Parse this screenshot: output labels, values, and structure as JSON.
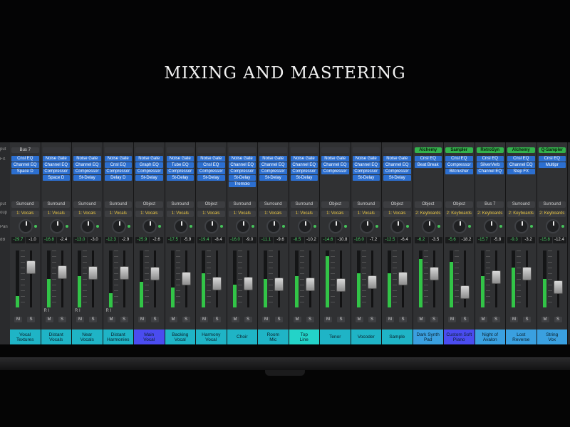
{
  "title": "MIXING AND MASTERING",
  "row_labels": [
    "put",
    "FX",
    "put",
    "oup",
    "Pan",
    "dB"
  ],
  "channels": [
    {
      "name": "Vocal\nTextures",
      "color": "#1fb4c6",
      "io": "Bus 7",
      "io_green": false,
      "plugins": [
        "Cnsl EQ",
        "Channel EQ",
        "Space D"
      ],
      "output": "Surround",
      "group": "1: Vocals",
      "vol": "-29.7",
      "peak": "-1.0",
      "meter": 0.2,
      "fader": 0.75
    },
    {
      "name": "Distant\nVocals",
      "color": "#1fb4c6",
      "io": "",
      "io_green": false,
      "plugins": [
        "Noise Gate",
        "Channel EQ",
        "Compressor",
        "Space D"
      ],
      "output": "Surround",
      "group": "1: Vocals",
      "vol": "-16.8",
      "peak": "-2.4",
      "meter": 0.5,
      "fader": 0.65
    },
    {
      "name": "Near\nVocals",
      "color": "#1fb4c6",
      "io": "",
      "io_green": false,
      "plugins": [
        "Noise Gate",
        "Channel EQ",
        "Compressor",
        "St-Delay"
      ],
      "output": "Surround",
      "group": "1: Vocals",
      "vol": "-13.0",
      "peak": "-3.0",
      "meter": 0.55,
      "fader": 0.63
    },
    {
      "name": "Distant\nHarmonies",
      "color": "#1fb4c6",
      "io": "",
      "io_green": false,
      "plugins": [
        "Noise Gate",
        "Cnsl EQ",
        "Compressor",
        "Delay D"
      ],
      "output": "Surround",
      "group": "1: Vocals",
      "vol": "-12.3",
      "peak": "-2.9",
      "meter": 0.25,
      "fader": 0.63
    },
    {
      "name": "Main\nVocal",
      "color": "#4a4cf0",
      "io": "",
      "io_green": false,
      "plugins": [
        "Noise Gate",
        "Graph EQ",
        "Compressor",
        "St-Delay"
      ],
      "output": "Object",
      "group": "1: Vocals",
      "vol": "-25.9",
      "peak": "-2.6",
      "meter": 0.45,
      "fader": 0.62
    },
    {
      "name": "Backing\nVocal",
      "color": "#1fb4c6",
      "io": "",
      "io_green": false,
      "plugins": [
        "Noise Gate",
        "Tube EQ",
        "Compressor",
        "St-Delay"
      ],
      "output": "Surround",
      "group": "1: Vocals",
      "vol": "-17.5",
      "peak": "-5.9",
      "meter": 0.35,
      "fader": 0.52
    },
    {
      "name": "Harmony\nVocal",
      "color": "#1fb4c6",
      "io": "",
      "io_green": false,
      "plugins": [
        "Noise Gate",
        "Cnsl EQ",
        "Compressor",
        "St-Delay"
      ],
      "output": "Object",
      "group": "1: Vocals",
      "vol": "-19.4",
      "peak": "-8.4",
      "meter": 0.6,
      "fader": 0.42
    },
    {
      "name": "Choir",
      "color": "#1fb4c6",
      "io": "",
      "io_green": false,
      "plugins": [
        "Noise Gate",
        "Channel EQ",
        "Compressor",
        "St-Delay",
        "Tremolo"
      ],
      "output": "Surround",
      "group": "1: Vocals",
      "vol": "-16.0",
      "peak": "-9.0",
      "meter": 0.4,
      "fader": 0.42
    },
    {
      "name": "Room\nMic",
      "color": "#1fb4c6",
      "io": "",
      "io_green": false,
      "plugins": [
        "Noise Gate",
        "Channel EQ",
        "Compressor",
        "St-Delay"
      ],
      "output": "Surround",
      "group": "1: Vocals",
      "vol": "-11.1",
      "peak": "-9.6",
      "meter": 0.5,
      "fader": 0.4
    },
    {
      "name": "Top\nLine",
      "color": "#23d3c8",
      "io": "",
      "io_green": false,
      "plugins": [
        "Noise Gate",
        "Channel EQ",
        "Compressor",
        "St-Delay"
      ],
      "output": "Surround",
      "group": "1: Vocals",
      "vol": "-8.5",
      "peak": "-10.2",
      "meter": 0.55,
      "fader": 0.4
    },
    {
      "name": "Tenor",
      "color": "#1fb4c6",
      "io": "",
      "io_green": false,
      "plugins": [
        "Noise Gate",
        "Channel EQ",
        "Compressor"
      ],
      "output": "Object",
      "group": "1: Vocals",
      "vol": "-14.6",
      "peak": "-10.8",
      "meter": 0.9,
      "fader": 0.38
    },
    {
      "name": "Vocoder",
      "color": "#1fb4c6",
      "io": "",
      "io_green": false,
      "plugins": [
        "Noise Gate",
        "Channel EQ",
        "Compressor",
        "St-Delay"
      ],
      "output": "Surround",
      "group": "1: Vocals",
      "vol": "-16.0",
      "peak": "-7.2",
      "meter": 0.6,
      "fader": 0.45
    },
    {
      "name": "Sample",
      "color": "#1fb4c6",
      "io": "",
      "io_green": false,
      "plugins": [
        "Noise Gate",
        "Channel EQ",
        "Compressor",
        "St-Delay"
      ],
      "output": "Object",
      "group": "1: Vocals",
      "vol": "-12.5",
      "peak": "-6.4",
      "meter": 0.6,
      "fader": 0.52
    },
    {
      "name": "Dark Synth\nPad",
      "color": "#3aa0e0",
      "io": "Alchemy",
      "io_green": true,
      "plugins": [
        "Cnsl EQ",
        "Beat Break"
      ],
      "output": "Object",
      "group": "2: Keyboards",
      "vol": "-6.2",
      "peak": "-3.5",
      "meter": 0.85,
      "fader": 0.62
    },
    {
      "name": "Custom Soft\nPiano",
      "color": "#4a4cf0",
      "io": "Sampler",
      "io_green": true,
      "plugins": [
        "Cnsl EQ",
        "Compressor",
        "Bitcrusher"
      ],
      "output": "Object",
      "group": "2: Keyboards",
      "vol": "-5.6",
      "peak": "-18.2",
      "meter": 0.8,
      "fader": 0.25
    },
    {
      "name": "Night of\nAvalon",
      "color": "#3aa0e0",
      "io": "RetroSyn",
      "io_green": true,
      "plugins": [
        "Cnsl EQ",
        "SilverVerb",
        "Channel EQ"
      ],
      "output": "Bus 7",
      "group": "2: Keyboards",
      "vol": "-15.7",
      "peak": "-5.8",
      "meter": 0.55,
      "fader": 0.55
    },
    {
      "name": "Lost\nReverse",
      "color": "#3aa0e0",
      "io": "Alchemy",
      "io_green": true,
      "plugins": [
        "Cnsl EQ",
        "Channel EQ",
        "Step FX"
      ],
      "output": "Surround",
      "group": "2: Keyboards",
      "vol": "-9.3",
      "peak": "-3.2",
      "meter": 0.7,
      "fader": 0.62
    },
    {
      "name": "String\nVox",
      "color": "#3aa0e0",
      "io": "Q-Sampler",
      "io_green": true,
      "plugins": [
        "Cnsl EQ",
        "Multipr"
      ],
      "output": "Surround",
      "group": "2: Keyboards",
      "vol": "-15.8",
      "peak": "-12.4",
      "meter": 0.5,
      "fader": 0.35
    }
  ],
  "button_labels": {
    "mute": "M",
    "solo": "S",
    "read": "R",
    "input": "I"
  }
}
